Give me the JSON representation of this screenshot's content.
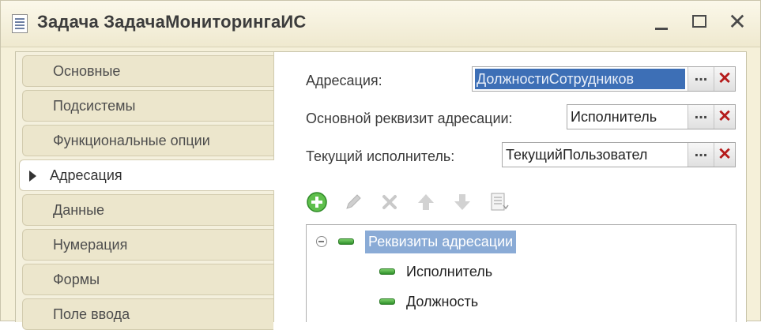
{
  "window": {
    "title": "Задача ЗадачаМониторингаИС",
    "controls": {
      "minimize": "_",
      "close": "✕"
    }
  },
  "tabs": [
    {
      "label": "Основные",
      "active": false
    },
    {
      "label": "Подсистемы",
      "active": false
    },
    {
      "label": "Функциональные опции",
      "active": false
    },
    {
      "label": "Адресация",
      "active": true
    },
    {
      "label": "Данные",
      "active": false
    },
    {
      "label": "Нумерация",
      "active": false
    },
    {
      "label": "Формы",
      "active": false
    },
    {
      "label": "Поле ввода",
      "active": false
    }
  ],
  "fields": {
    "addressing": {
      "label": "Адресация:",
      "value": "ДолжностиСотрудников"
    },
    "main_attribute": {
      "label": "Основной реквизит адресации:",
      "value": "Исполнитель"
    },
    "current_executor": {
      "label": "Текущий исполнитель:",
      "value": "ТекущийПользовател"
    },
    "select_button": "...",
    "clear_button": "✕"
  },
  "toolbar": {
    "icons": [
      "add-icon",
      "edit-icon",
      "delete-icon",
      "move-up-icon",
      "move-down-icon",
      "list-options-icon"
    ]
  },
  "tree": {
    "root": "Реквизиты адресации",
    "children": [
      "Исполнитель",
      "Должность"
    ]
  },
  "colors": {
    "window_bg": "#f5f0d9",
    "selection": "#3d6fb6",
    "tree_highlight": "#8aabd6",
    "clear_red": "#b51b1b",
    "add_green": "#4caf3c"
  }
}
